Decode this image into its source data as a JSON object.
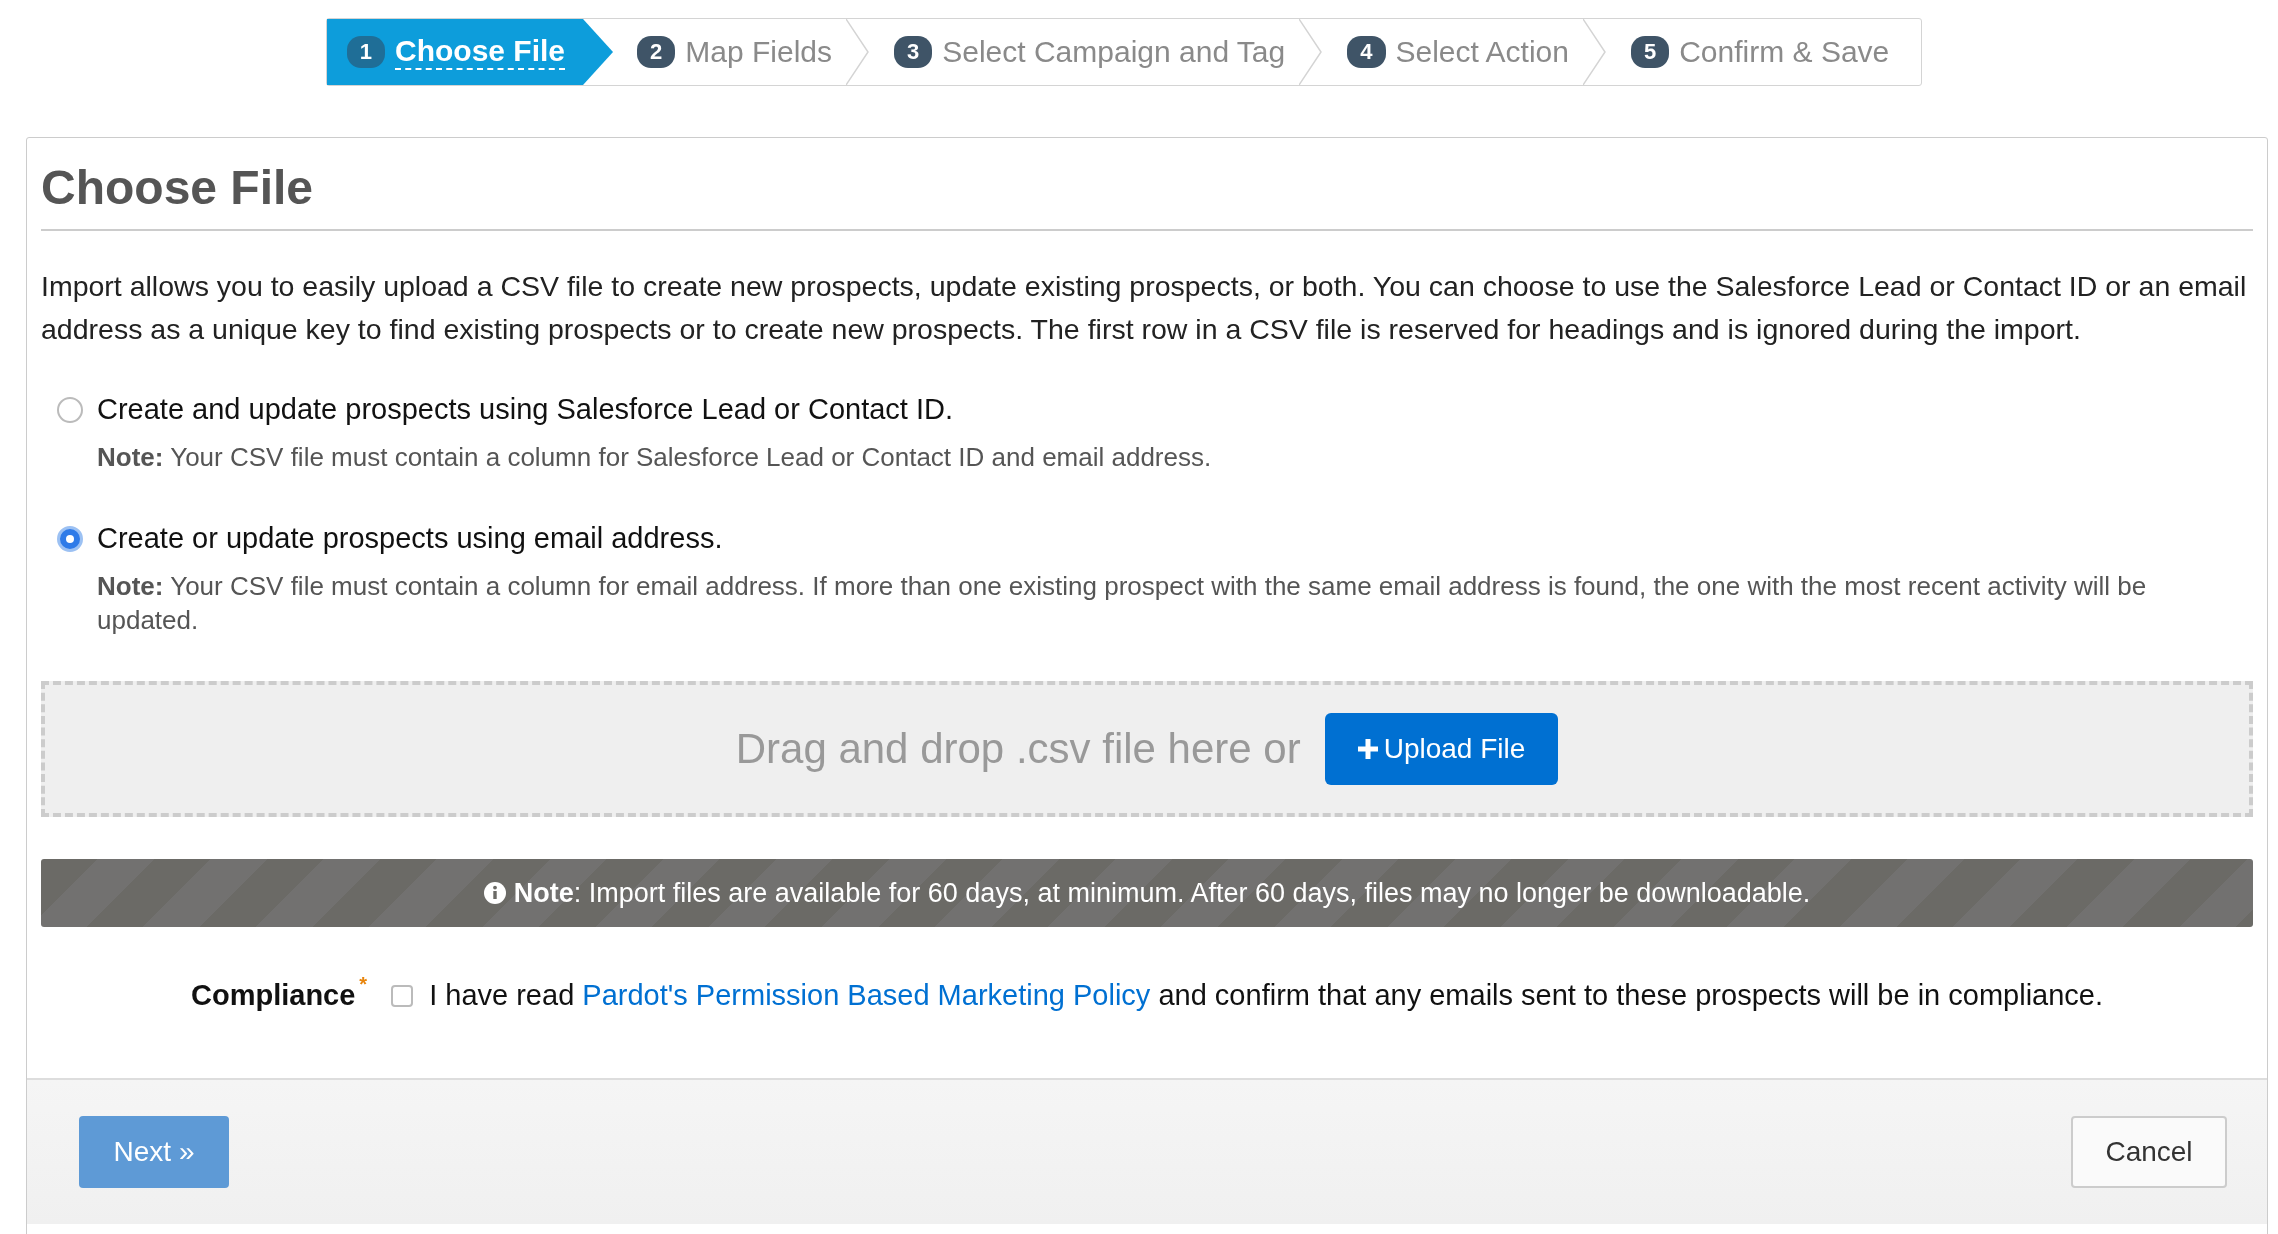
{
  "steps": [
    {
      "number": "1",
      "label": "Choose File",
      "selected": true
    },
    {
      "number": "2",
      "label": "Map Fields",
      "selected": false
    },
    {
      "number": "3",
      "label": "Select Campaign and Tag",
      "selected": false
    },
    {
      "number": "4",
      "label": "Select Action",
      "selected": false
    },
    {
      "number": "5",
      "label": "Confirm & Save",
      "selected": false
    }
  ],
  "title": "Choose File",
  "intro": "Import allows you to easily upload a CSV file to create new prospects, update existing prospects, or both. You can choose to use the Salesforce Lead or Contact ID or an email address as a unique key to find existing prospects or to create new prospects. The first row in a CSV file is reserved for headings and is ignored during the import.",
  "options": [
    {
      "label": "Create and update prospects using Salesforce Lead or Contact ID.",
      "note": "**Note:** Your CSV file must contain a column for Salesforce Lead or Contact ID and email address.",
      "selected": false
    },
    {
      "label": "Create or update prospects using email address.",
      "note": "**Note:** Your CSV file must contain a column for email address. If more than one existing prospect with the same email address is found, the one with the most recent activity will be updated.",
      "selected": true
    }
  ],
  "dropzone": {
    "prompt": "Drag and drop .csv file here or",
    "button": "Upload File"
  },
  "notice": "**Note**: Import files are available for 60 days, at minimum. After 60 days, files may no longer be downloadable.",
  "compliance": {
    "label": "Compliance",
    "required_mark": "*",
    "checked": false,
    "text_before": "I have read",
    "link": "Pardot's Permission Based Marketing Policy",
    "text_after": "and confirm that any emails sent to these prospects will be in compliance."
  },
  "footer": {
    "next": {
      "label": "Next »",
      "disabled": true
    },
    "cancel": "Cancel"
  }
}
